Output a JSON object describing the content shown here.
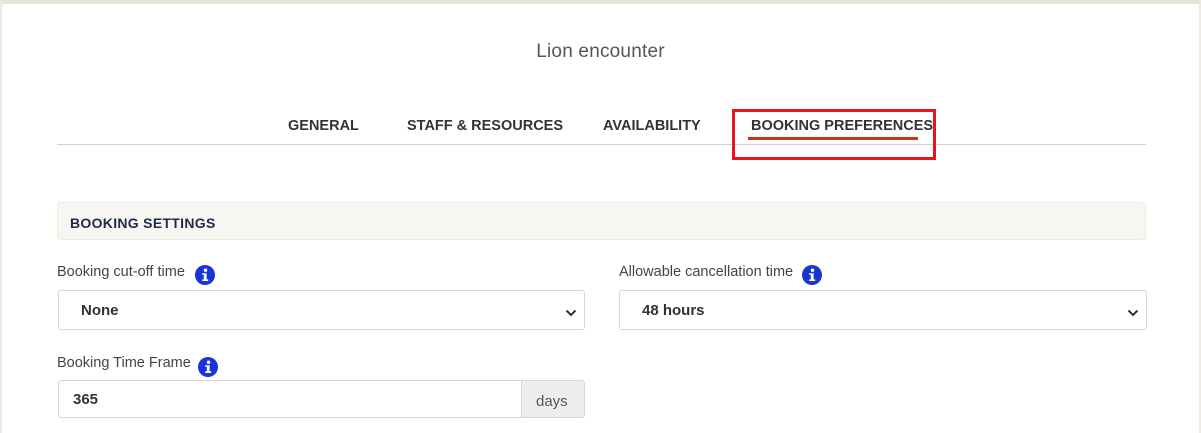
{
  "page": {
    "title": "Lion encounter"
  },
  "tabs": [
    {
      "label": "GENERAL",
      "active": false
    },
    {
      "label": "STAFF & RESOURCES",
      "active": false
    },
    {
      "label": "AVAILABILITY",
      "active": false
    },
    {
      "label": "BOOKING PREFERENCES",
      "active": true
    }
  ],
  "section": {
    "heading": "BOOKING SETTINGS"
  },
  "fields": {
    "cutoff": {
      "label": "Booking cut-off time",
      "value": "None",
      "icon": "info-icon"
    },
    "cancellation": {
      "label": "Allowable cancellation time",
      "value": "48 hours",
      "icon": "info-icon"
    },
    "timeframe": {
      "label": "Booking Time Frame",
      "value": "365",
      "unit": "days",
      "icon": "info-icon"
    }
  },
  "colors": {
    "active_tab_underline": "#c0391b",
    "highlight_box": "#e8141c",
    "info_icon": "#1a35d6",
    "section_heading": "#1f2a4d"
  }
}
